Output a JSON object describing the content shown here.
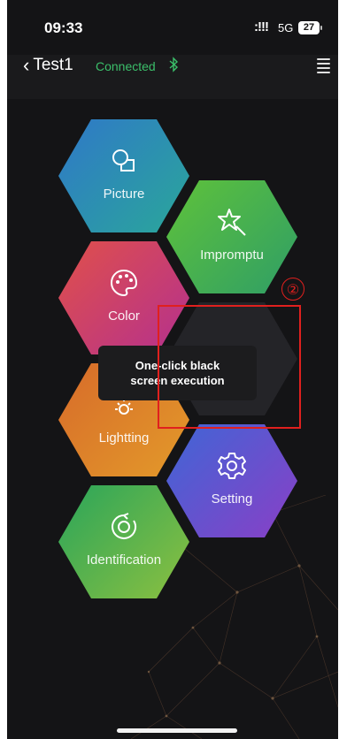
{
  "status_bar": {
    "time": "09:33",
    "signal": ":!!!",
    "network": "5G",
    "battery": "27"
  },
  "nav": {
    "back_label": "Test1",
    "status": "Connected",
    "bluetooth_icon": "bluetooth-icon",
    "menu_icon": "list-menu-icon",
    "status_color": "#3bbf6a"
  },
  "tiles": [
    {
      "label": "Picture",
      "icon": "picture-icon"
    },
    {
      "label": "Impromptu",
      "icon": "magic-star-icon"
    },
    {
      "label": "Color",
      "icon": "palette-icon"
    },
    {
      "label": "",
      "icon": ""
    },
    {
      "label": "Lightting",
      "icon": "sun-icon"
    },
    {
      "label": "Setting",
      "icon": "gear-icon"
    },
    {
      "label": "Identification",
      "icon": "refresh-target-icon"
    }
  ],
  "toast": {
    "line1": "One-click black",
    "line2": "screen execution"
  },
  "annotation": {
    "step_marker": "②",
    "color": "#e0201e"
  }
}
